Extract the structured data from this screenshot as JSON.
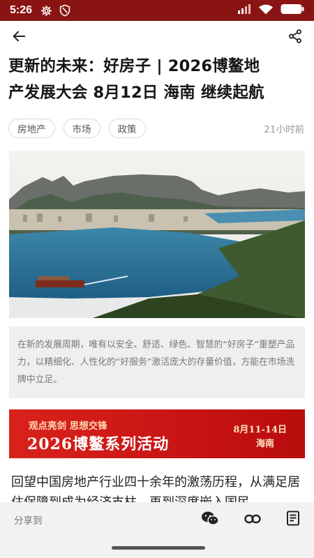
{
  "status_bar": {
    "time": "5:26",
    "icons": [
      "settings-gear-icon",
      "shield-icon",
      "signal-icon",
      "wifi-icon",
      "battery-icon"
    ],
    "color": "#8a1414"
  },
  "app_bar": {
    "back_icon": "arrow-left-icon",
    "share_icon": "share-nodes-icon"
  },
  "article": {
    "title_line1": "更新的未来：好房子 | 2026博鳌地",
    "title_line2": "产发展大会 8月12日 海南 继续起航",
    "tags": [
      "房地产",
      "市场",
      "政策"
    ],
    "time": "21小时前",
    "image_icon": "coastal-city-photo",
    "caption": "在新的发展周期，唯有以安全、舒适、绿色、智慧的“好房子”重塑产品力，以精细化、人性化的“好服务”激活庞大的存量价值，方能在市场洗牌中立足。",
    "banner": {
      "top_text": "观点亮剑 思想交锋",
      "main_text": "2026博鳌系列活动",
      "date": "8月11-14日",
      "place": "海南",
      "color": "#d8221b"
    },
    "body": "回望中国房地产行业四十余年的激荡历程，从满足居住保障到成为经济支柱，再到深度嵌入国民"
  },
  "bottom_bar": {
    "share_label": "分享到",
    "icons": [
      "wechat-icon",
      "link-icon",
      "document-icon"
    ]
  }
}
